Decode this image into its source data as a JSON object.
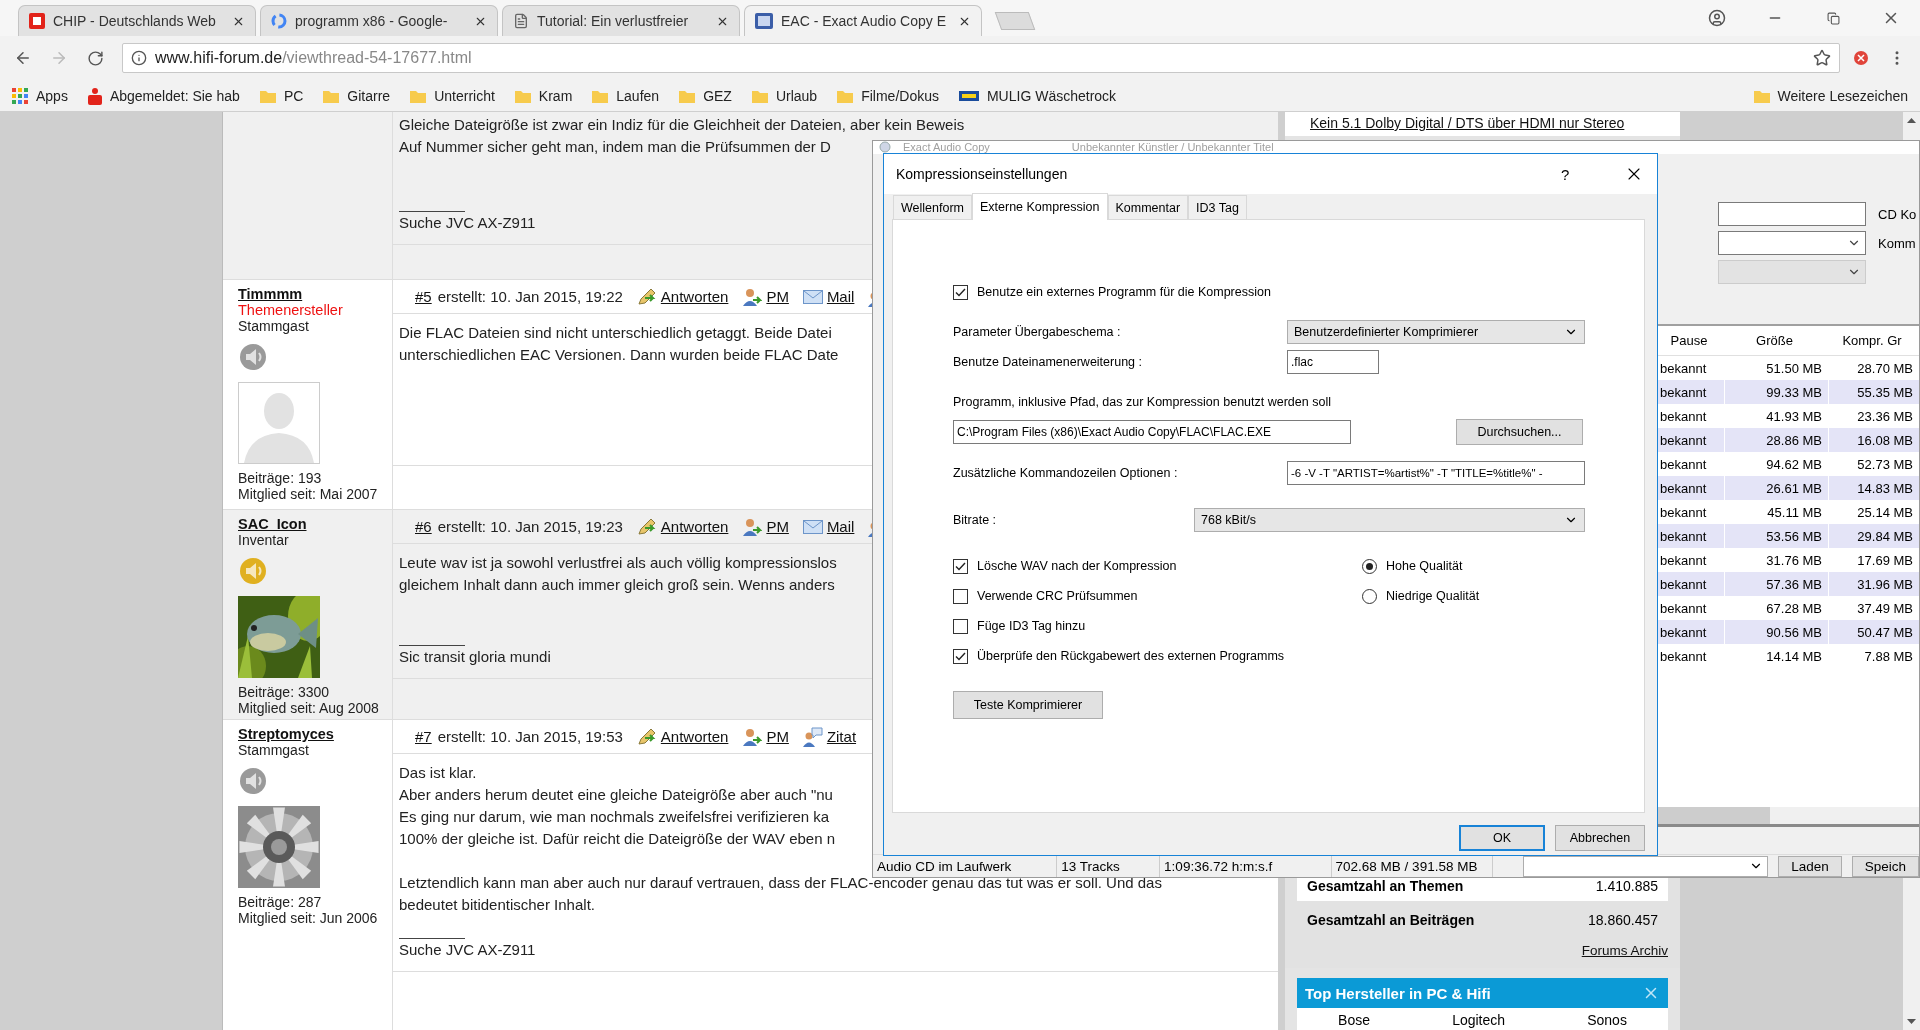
{
  "browser": {
    "tabs": [
      {
        "title": "CHIP - Deutschlands Web",
        "selected": false
      },
      {
        "title": "programm x86 - Google-",
        "selected": false
      },
      {
        "title": "Tutorial: Ein verlustfreier",
        "selected": false
      },
      {
        "title": "EAC - Exact Audio Copy E",
        "selected": true
      }
    ],
    "forward_disabled": true,
    "address": {
      "host": "www.hifi-forum.de",
      "path": "/viewthread-54-17677.html"
    },
    "bookmarks": [
      {
        "label": "Apps",
        "kind": "apps"
      },
      {
        "label": "Abgemeldet: Sie hab",
        "kind": "site"
      },
      {
        "label": "PC",
        "kind": "folder"
      },
      {
        "label": "Gitarre",
        "kind": "folder"
      },
      {
        "label": "Unterricht",
        "kind": "folder"
      },
      {
        "label": "Kram",
        "kind": "folder"
      },
      {
        "label": "Laufen",
        "kind": "folder"
      },
      {
        "label": "GEZ",
        "kind": "folder"
      },
      {
        "label": "Urlaub",
        "kind": "folder"
      },
      {
        "label": "Filme/Dokus",
        "kind": "folder"
      },
      {
        "label": "MULIG Wäschetrock",
        "kind": "store"
      }
    ],
    "other_bookmarks": "Weitere Lesezeichen"
  },
  "forum": {
    "posts": [
      {
        "paragraphs": [
          [
            "Gleiche Dateigröße ist zwar ein Indiz für die Gleichheit der Dateien, aber kein Beweis",
            "Auf Nummer sicher geht man, indem man die Prüfsummen der D"
          ]
        ],
        "signature": "Suche JVC AX-Z911"
      },
      {
        "user": {
          "name": "Timmmm",
          "role": "Themenersteller",
          "rank": "Stammgast",
          "rank_icon": {
            "color": "#9a9a9a"
          },
          "avatar": {
            "kind": "silhouette"
          },
          "posts_count": "Beiträge: 193",
          "member_since": "Mitglied seit: Mai 2007"
        },
        "number": "#5",
        "created": "erstellt: 10. Jan 2015, 19:22",
        "actions": [
          {
            "kind": "reply",
            "label": "Antworten"
          },
          {
            "kind": "pm",
            "label": "PM"
          },
          {
            "kind": "mail",
            "label": "Mail"
          },
          {
            "kind": "quote"
          }
        ],
        "paragraphs": [
          [
            "Die FLAC Dateien sind nicht unterschiedlich getaggt. Beide Datei",
            "unterschiedlichen EAC Versionen. Dann wurden beide FLAC Date"
          ]
        ]
      },
      {
        "user": {
          "name": "SAC_Icon",
          "rank": "Inventar",
          "rank_icon": {
            "color": "#e0b020"
          },
          "posts_count": "Beiträge: 3300",
          "member_since": "Mitglied seit: Aug 2008"
        },
        "number": "#6",
        "created": "erstellt: 10. Jan 2015, 19:23",
        "actions": [
          {
            "kind": "reply",
            "label": "Antworten"
          },
          {
            "kind": "pm",
            "label": "PM"
          },
          {
            "kind": "mail",
            "label": "Mail"
          },
          {
            "kind": "quote"
          }
        ],
        "paragraphs": [
          [
            "Leute wav ist ja sowohl verlustfrei als auch völlig kompressionslos",
            "gleichem Inhalt dann auch immer gleich groß sein. Wenns anders"
          ]
        ],
        "signature": "Sic transit gloria mundi"
      },
      {
        "user": {
          "name": "Streptomyces",
          "rank": "Stammgast",
          "rank_icon": {
            "color": "#9a9a9a"
          },
          "posts_count": "Beiträge: 287",
          "member_since": "Mitglied seit: Jun 2006"
        },
        "number": "#7",
        "created": "erstellt: 10. Jan 2015, 19:53",
        "actions": [
          {
            "kind": "reply",
            "label": "Antworten"
          },
          {
            "kind": "pm",
            "label": "PM"
          },
          {
            "kind": "quote",
            "label": "Zitat"
          }
        ],
        "paragraphs": [
          [
            "Das ist klar.",
            "Aber anders herum deutet eine gleiche Dateigröße aber auch \"nu",
            "Es ging nur darum, wie man nochmals zweifelsfrei verifizieren ka",
            "100% der gleiche ist. Dafür reicht die Dateigröße der WAV eben n"
          ],
          [
            "Letztendlich kann man aber auch nur darauf vertrauen, dass der FLAC-encoder genau das tut was er soll. Und das",
            "bedeutet bitidentischer Inhalt."
          ]
        ],
        "signature": "Suche JVC AX-Z911"
      }
    ],
    "sidebar": {
      "top_link": "Kein 5.1 Dolby Digital / DTS über HDMI nur Stereo",
      "stats": [
        {
          "label": "Gesamtzahl an Themen",
          "value": "1.410.885"
        },
        {
          "label": "Gesamtzahl an Beiträgen",
          "value": "18.860.457"
        }
      ],
      "archive_link": "Forums Archiv",
      "makers": {
        "title": "Top Hersteller in PC & Hifi",
        "items": [
          "Bose",
          "Logitech",
          "Sonos"
        ]
      }
    }
  },
  "eac_window": {
    "title": "Exact Audio Copy",
    "subtitle": "Unbekannter Künstler / Unbekannter Titel",
    "fields": [
      {
        "kind": "input",
        "label": "CD Ko"
      },
      {
        "kind": "select",
        "label": "Komm"
      },
      {
        "kind": "select",
        "disabled": true
      }
    ],
    "table": {
      "columns": [
        "Pause",
        "Größe",
        "Kompr. Gr"
      ],
      "rows": [
        [
          "bekannt",
          "51.50 MB",
          "28.70 MB"
        ],
        [
          "bekannt",
          "99.33 MB",
          "55.35 MB"
        ],
        [
          "bekannt",
          "41.93 MB",
          "23.36 MB"
        ],
        [
          "bekannt",
          "28.86 MB",
          "16.08 MB"
        ],
        [
          "bekannt",
          "94.62 MB",
          "52.73 MB"
        ],
        [
          "bekannt",
          "26.61 MB",
          "14.83 MB"
        ],
        [
          "bekannt",
          "45.11 MB",
          "25.14 MB"
        ],
        [
          "bekannt",
          "53.56 MB",
          "29.84 MB"
        ],
        [
          "bekannt",
          "31.76 MB",
          "17.69 MB"
        ],
        [
          "bekannt",
          "57.36 MB",
          "31.96 MB"
        ],
        [
          "bekannt",
          "67.28 MB",
          "37.49 MB"
        ],
        [
          "bekannt",
          "90.56 MB",
          "50.47 MB"
        ],
        [
          "bekannt",
          "14.14 MB",
          "7.88 MB"
        ]
      ]
    },
    "status": [
      "Audio CD im Laufwerk",
      "13 Tracks",
      "1:09:36.72 h:m:s.f",
      "702.68 MB / 391.58 MB"
    ],
    "buttons": [
      "Laden",
      "Speich"
    ]
  },
  "dialog": {
    "title": "Kompressionseinstellungen",
    "help": "?",
    "tabs": [
      {
        "label": "Wellenform",
        "selected": false
      },
      {
        "label": "Externe Kompression",
        "selected": true
      },
      {
        "label": "Kommentar",
        "selected": false
      },
      {
        "label": "ID3 Tag",
        "selected": false
      }
    ],
    "use_external": {
      "label": "Benutze ein externes Programm für die Kompression",
      "checked": true
    },
    "scheme": {
      "label": "Parameter Übergabeschema :",
      "value": "Benutzerdefinierter Komprimierer"
    },
    "extension": {
      "label": "Benutze Dateinamenerweiterung :",
      "value": ".flac"
    },
    "program": {
      "label": "Programm, inklusive Pfad, das zur Kompression benutzt werden soll",
      "value": "C:\\Program Files (x86)\\Exact Audio Copy\\FLAC\\FLAC.EXE",
      "button": "Durchsuchen..."
    },
    "options": {
      "label": "Zusätzliche Kommandozeilen Optionen :",
      "value": "-6 -V -T \"ARTIST=%artist%\" -T \"TITLE=%title%\" -"
    },
    "bitrate": {
      "label": "Bitrate :",
      "value": "768 kBit/s"
    },
    "checks": [
      {
        "label": "Lösche WAV nach der Kompression",
        "checked": true
      },
      {
        "label": "Verwende CRC Prüfsummen",
        "checked": false
      },
      {
        "label": "Füge ID3 Tag hinzu",
        "checked": false
      },
      {
        "label": "Überprüfe den Rückgabewert des externen Programms",
        "checked": true
      }
    ],
    "quality": [
      {
        "label": "Hohe Qualität",
        "selected": true
      },
      {
        "label": "Niedrige Qualität",
        "selected": false
      }
    ],
    "test_button": "Teste Komprimierer",
    "buttons": [
      {
        "label": "OK",
        "default": true
      },
      {
        "label": "Abbrechen",
        "default": false
      }
    ]
  }
}
